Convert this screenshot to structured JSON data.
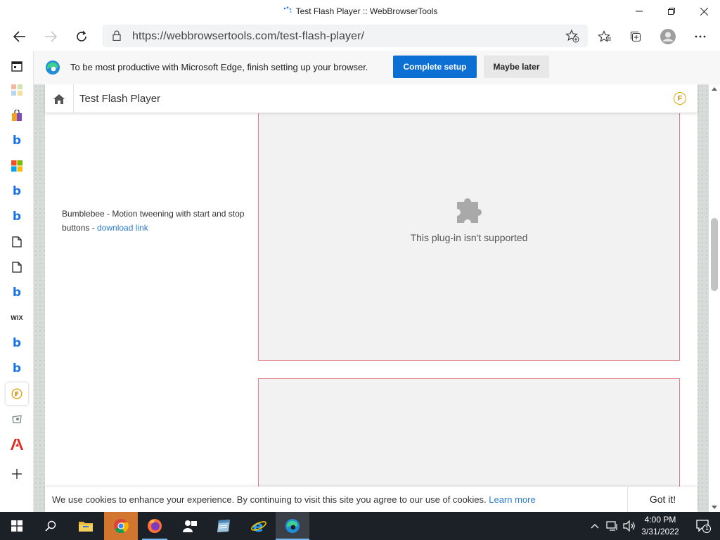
{
  "window": {
    "title": "Test Flash Player :: WebBrowserTools"
  },
  "address_bar": {
    "url": "https://webbrowsertools.com/test-flash-player/"
  },
  "setup_banner": {
    "message": "To be most productive with Microsoft Edge, finish setting up your browser.",
    "primary_label": "Complete setup",
    "secondary_label": "Maybe later"
  },
  "sidebar": {
    "items": [
      "calendar-icon",
      "apps-icon",
      "shopping-icon",
      "bing-icon",
      "microsoft-icon",
      "bing-icon",
      "bing-icon",
      "document-icon",
      "document-icon",
      "bing-icon",
      "wix-icon",
      "bing-icon",
      "bing-icon",
      "flash-tester-icon",
      "gallery-icon",
      "adobe-icon"
    ],
    "wix_label": "WIX",
    "b_label": "b"
  },
  "site": {
    "header_title": "Test Flash Player",
    "badge_letter": "F",
    "description": "Bumblebee - Motion tweening with start and stop buttons - ",
    "download_link": "download link",
    "plugin_message": "This plug-in isn't supported"
  },
  "cookie_bar": {
    "text": "We use cookies to enhance your experience. By continuing to visit this site you agree to our use of cookies. ",
    "learn_more": "Learn more",
    "got_it": "Got it!"
  },
  "taskbar": {
    "time": "4:00 PM",
    "date": "3/31/2022",
    "notification_count": "1"
  },
  "colors": {
    "accent": "#0b6fd4",
    "plugin_border": "#e67d84",
    "link": "#2a7bd1",
    "taskbar": "#1c2027"
  }
}
